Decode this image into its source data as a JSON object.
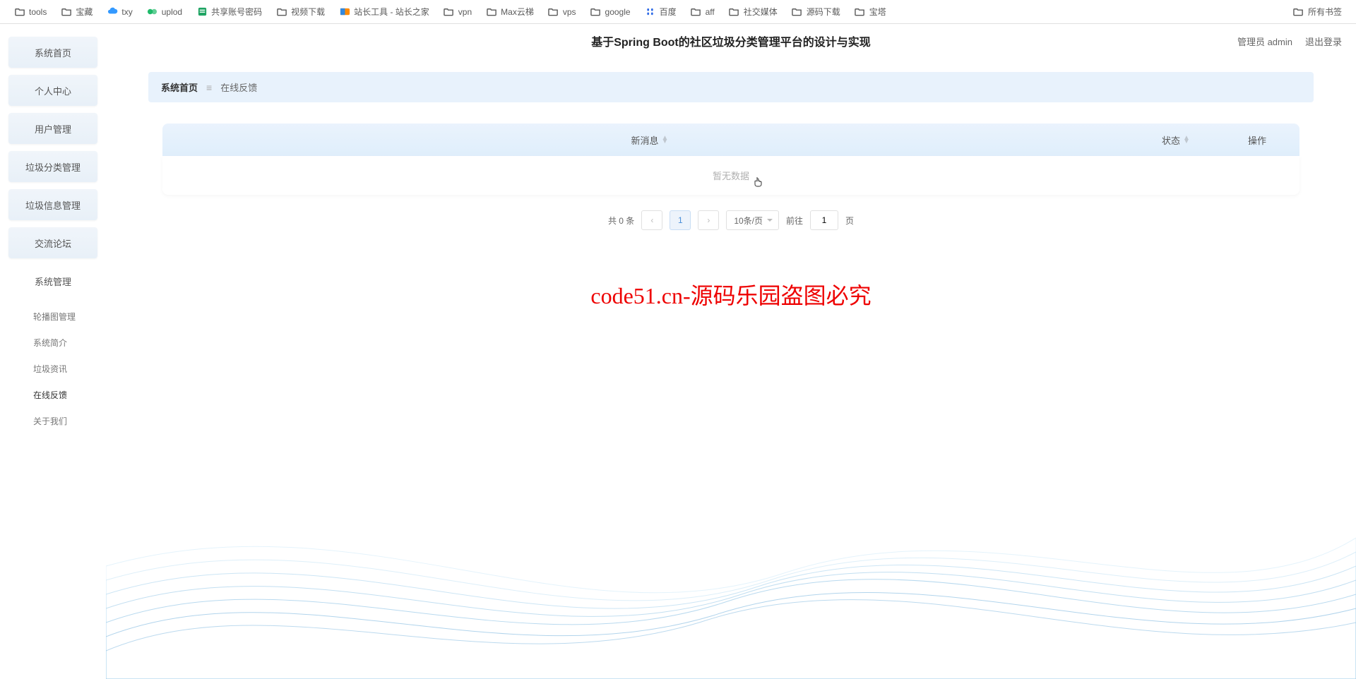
{
  "bookmarks": [
    {
      "label": "tools",
      "icon": "folder"
    },
    {
      "label": "宝藏",
      "icon": "folder"
    },
    {
      "label": "txy",
      "icon": "cloud",
      "color": "#3399ff"
    },
    {
      "label": "uplod",
      "icon": "uplod",
      "color": "#1fba6a"
    },
    {
      "label": "共享账号密码",
      "icon": "doc",
      "color": "#1fa463"
    },
    {
      "label": "视频下载",
      "icon": "folder"
    },
    {
      "label": "站长工具 - 站长之家",
      "icon": "zz",
      "color": "#ff8a00"
    },
    {
      "label": "vpn",
      "icon": "folder"
    },
    {
      "label": "Max云梯",
      "icon": "folder"
    },
    {
      "label": "vps",
      "icon": "folder"
    },
    {
      "label": "google",
      "icon": "folder"
    },
    {
      "label": "百度",
      "icon": "baidu",
      "color": "#2e6ae6"
    },
    {
      "label": "aff",
      "icon": "folder"
    },
    {
      "label": "社交媒体",
      "icon": "folder"
    },
    {
      "label": "源码下载",
      "icon": "folder"
    },
    {
      "label": "宝塔",
      "icon": "folder"
    }
  ],
  "bookmarks_right": {
    "label": "所有书签",
    "icon": "folder"
  },
  "sidebar": {
    "items": [
      {
        "label": "系统首页"
      },
      {
        "label": "个人中心"
      },
      {
        "label": "用户管理"
      },
      {
        "label": "垃圾分类管理"
      },
      {
        "label": "垃圾信息管理"
      },
      {
        "label": "交流论坛"
      },
      {
        "label": "系统管理"
      }
    ],
    "sub_items": [
      {
        "label": "轮播图管理"
      },
      {
        "label": "系统简介"
      },
      {
        "label": "垃圾资讯"
      },
      {
        "label": "在线反馈"
      },
      {
        "label": "关于我们"
      }
    ]
  },
  "header": {
    "title": "基于Spring Boot的社区垃圾分类管理平台的设计与实现",
    "user_role": "管理员 admin",
    "logout": "退出登录"
  },
  "breadcrumb": {
    "home": "系统首页",
    "sep": "≡",
    "current": "在线反馈"
  },
  "table": {
    "col_msg": "新消息",
    "col_status": "状态",
    "col_action": "操作",
    "empty": "暂无数据"
  },
  "pagination": {
    "total": "共 0 条",
    "prev": "‹",
    "page1": "1",
    "next": "›",
    "per_page": "10条/页",
    "goto": "前往",
    "page_num": "1",
    "page_suffix": "页"
  },
  "watermark": "code51.cn-源码乐园盗图必究"
}
